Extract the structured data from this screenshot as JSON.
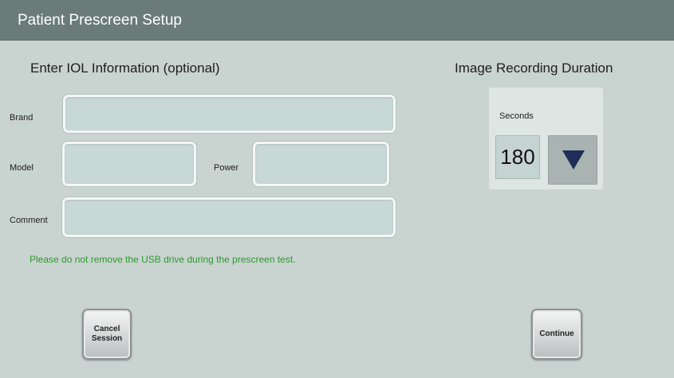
{
  "window": {
    "title": "Patient Prescreen Setup"
  },
  "iol": {
    "heading": "Enter IOL Information (optional)",
    "brand": {
      "label": "Brand",
      "value": ""
    },
    "model": {
      "label": "Model",
      "value": ""
    },
    "power": {
      "label": "Power",
      "value": ""
    },
    "comment": {
      "label": "Comment",
      "value": ""
    }
  },
  "notice": "Please do not remove the USB drive during the prescreen test.",
  "duration": {
    "heading": "Image Recording Duration",
    "unit_label": "Seconds",
    "value": "180",
    "down_icon": "down-triangle-icon"
  },
  "buttons": {
    "cancel": "Cancel\nSession",
    "continue": "Continue"
  },
  "colors": {
    "titlebar": "#6a7b79",
    "background": "#c9d3d0",
    "notice": "#2e9a2e",
    "arrow": "#1f2d59"
  }
}
